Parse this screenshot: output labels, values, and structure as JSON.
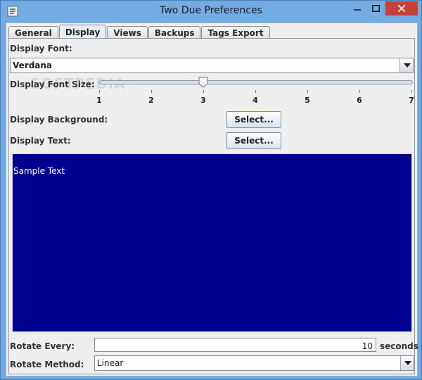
{
  "window": {
    "title": "Two Due Preferences",
    "accent": "#73ace3",
    "close_color": "#c7403a"
  },
  "tabs": [
    {
      "label": "General",
      "active": false
    },
    {
      "label": "Display",
      "active": true
    },
    {
      "label": "Views",
      "active": false
    },
    {
      "label": "Backups",
      "active": false
    },
    {
      "label": "Tags Export",
      "active": false
    }
  ],
  "display": {
    "font_label": "Display Font:",
    "font_value": "Verdana",
    "font_size_label": "Display Font Size:",
    "font_size_ticks": [
      "1",
      "2",
      "3",
      "4",
      "5",
      "6",
      "7"
    ],
    "font_size_value": 3,
    "background_label": "Display Background:",
    "background_button": "Select...",
    "text_label": "Display Text:",
    "text_button": "Select...",
    "preview_text": "Sample Text",
    "preview_background": "#000090",
    "preview_foreground": "#ffffff",
    "rotate_every_label": "Rotate Every:",
    "rotate_every_value": "10",
    "rotate_every_unit": "seconds",
    "rotate_method_label": "Rotate Method:",
    "rotate_method_value": "Linear"
  },
  "watermark": "SOFTPEDIA"
}
